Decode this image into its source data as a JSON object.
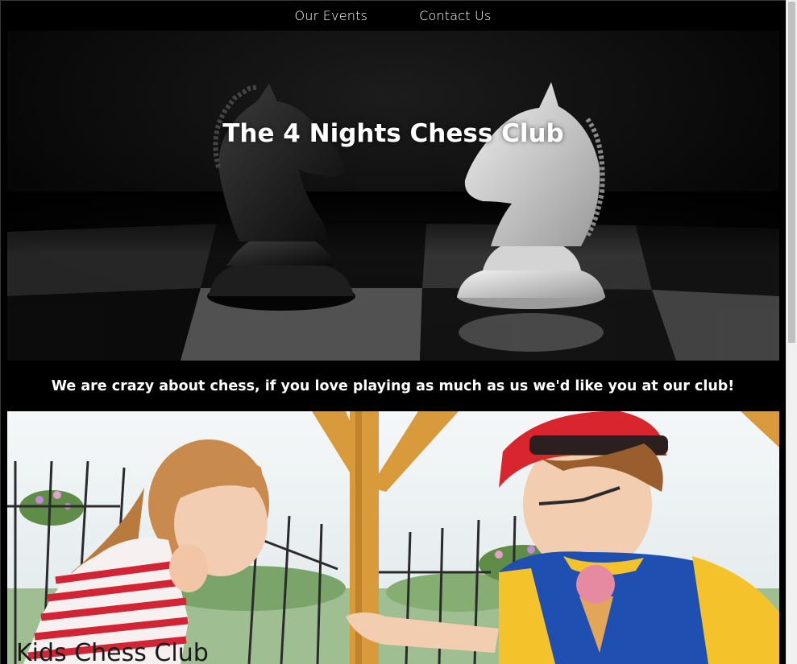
{
  "nav": {
    "items": [
      {
        "label": "Our Events"
      },
      {
        "label": "Contact Us"
      }
    ]
  },
  "hero": {
    "title": "The 4 Nights Chess Club"
  },
  "tagline": "We are crazy about chess, if you love playing as much as us we'd like you at our club!",
  "kids_section": {
    "title": "Kids Chess Club"
  },
  "colors": {
    "background": "#000000",
    "text_light": "#ffffff",
    "text_dark": "#1a1a1a"
  }
}
